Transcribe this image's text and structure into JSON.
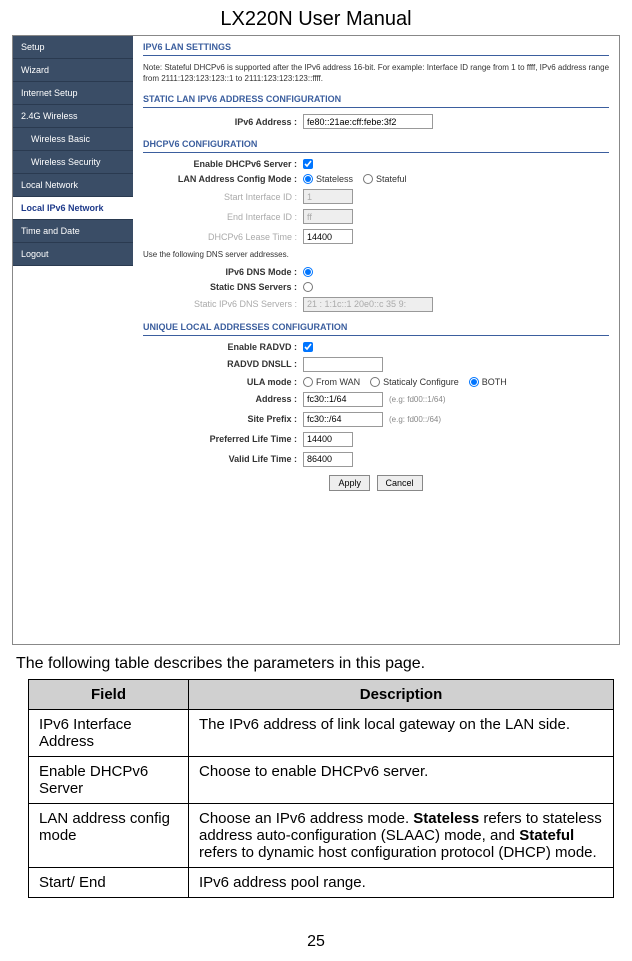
{
  "page": {
    "title": "LX220N User Manual",
    "number": "25",
    "intro": "The following table describes the parameters in this page."
  },
  "nav": {
    "items": [
      {
        "label": "Setup",
        "active": false,
        "nested": false
      },
      {
        "label": "Wizard",
        "active": false,
        "nested": false
      },
      {
        "label": "Internet Setup",
        "active": false,
        "nested": false
      },
      {
        "label": "2.4G Wireless",
        "active": false,
        "nested": false
      },
      {
        "label": "Wireless Basic",
        "active": false,
        "nested": true
      },
      {
        "label": "Wireless Security",
        "active": false,
        "nested": true
      },
      {
        "label": "Local Network",
        "active": false,
        "nested": false
      },
      {
        "label": "Local IPv6 Network",
        "active": true,
        "nested": false
      },
      {
        "label": "Time and Date",
        "active": false,
        "nested": false
      },
      {
        "label": "Logout",
        "active": false,
        "nested": false
      }
    ]
  },
  "sections": {
    "lan_title": "IPV6 LAN SETTINGS",
    "lan_note": "Note: Stateful DHCPv6 is supported after the IPv6 address 16-bit. For example: Interface ID range from 1 to ffff, IPv6 address range from 2111:123:123:123::1 to 2111:123:123:123::ffff.",
    "static_title": "STATIC LAN IPV6 ADDRESS CONFIGURATION",
    "dhcp_title": "DHCPV6 CONFIGURATION",
    "ula_title": "UNIQUE LOCAL ADDRESSES CONFIGURATION"
  },
  "form": {
    "ipv6_address_label": "IPv6 Address :",
    "ipv6_address_value": "fe80::21ae:cff:febe:3f2",
    "enable_dhcpv6_label": "Enable DHCPv6 Server :",
    "lan_config_label": "LAN Address Config Mode :",
    "lan_config_opt1": "Stateless",
    "lan_config_opt2": "Stateful",
    "start_id_label": "Start Interface ID :",
    "start_id_value": "1",
    "end_id_label": "End Interface ID :",
    "end_id_value": "ff",
    "lease_label": "DHCPv6 Lease Time :",
    "lease_value": "14400",
    "dns_note": "Use the following DNS server addresses.",
    "ipv6_dns_mode_label": "IPv6 DNS Mode :",
    "static_dns_label": "Static DNS Servers :",
    "static_ipv6_dns_label": "Static IPv6 DNS Servers :",
    "static_ipv6_dns_value": "21 : 1:1c::1 20e0::c 35 9:",
    "enable_radvd_label": "Enable RADVD :",
    "radvd_dnsll_label": "RADVD DNSLL :",
    "radvd_dnsll_value": "",
    "ula_mode_label": "ULA mode :",
    "ula_opt1": "From WAN",
    "ula_opt2": "Staticaly Configure",
    "ula_opt3": "BOTH",
    "address_label": "Address :",
    "address_value": "fc30::1/64",
    "address_hint": "(e.g: fd00::1/64)",
    "site_prefix_label": "Site Prefix :",
    "site_prefix_value": "fc30::/64",
    "site_prefix_hint": "(e.g: fd00::/64)",
    "preferred_life_label": "Preferred Life Time :",
    "preferred_life_value": "14400",
    "valid_life_label": "Valid Life Time :",
    "valid_life_value": "86400",
    "apply": "Apply",
    "cancel": "Cancel"
  },
  "table": {
    "header_field": "Field",
    "header_desc": "Description",
    "rows": [
      {
        "field": "IPv6 Interface Address",
        "desc_pre": "The IPv6 address of link local gateway on the LAN side.",
        "strong1": "",
        "desc_mid": "",
        "strong2": "",
        "desc_post": ""
      },
      {
        "field": "Enable DHCPv6 Server",
        "desc_pre": "Choose to enable DHCPv6 server.",
        "strong1": "",
        "desc_mid": "",
        "strong2": "",
        "desc_post": ""
      },
      {
        "field": "LAN address config mode",
        "desc_pre": "Choose an IPv6 address mode. ",
        "strong1": "Stateless",
        "desc_mid": " refers to stateless address auto-configuration (SLAAC) mode, and ",
        "strong2": "Stateful",
        "desc_post": " refers to dynamic host configuration protocol (DHCP) mode."
      },
      {
        "field": "Start/ End",
        "desc_pre": "IPv6 address pool range.",
        "strong1": "",
        "desc_mid": "",
        "strong2": "",
        "desc_post": ""
      }
    ]
  }
}
